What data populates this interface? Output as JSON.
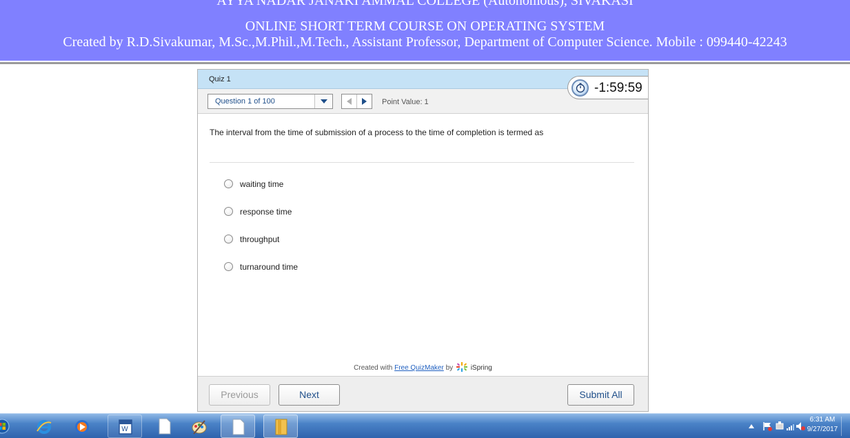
{
  "banner": {
    "line1": "AYYA NADAR JANAKI AMMAL COLLEGE (Autonomous), SIVAKASI",
    "line2": "ONLINE SHORT TERM COURSE ON OPERATING SYSTEM",
    "line3": "Created by R.D.Sivakumar, M.Sc.,M.Phil.,M.Tech., Assistant Professor, Department of Computer Science. Mobile : 099440-42243",
    "background": "#8080ff"
  },
  "quiz": {
    "title": "Quiz 1",
    "question_selector": "Question 1 of 100",
    "point_value": "Point Value: 1",
    "timer": "-1:59:59",
    "question": "The interval from the time of submission of a process to the time of completion is termed as",
    "options": [
      {
        "label": "waiting time"
      },
      {
        "label": "response time"
      },
      {
        "label": "throughput"
      },
      {
        "label": "turnaround time"
      }
    ],
    "credit": {
      "prefix": "Created with",
      "link": "Free QuizMaker",
      "by": "by",
      "brand": "iSpring"
    },
    "buttons": {
      "previous": "Previous",
      "next": "Next",
      "submit": "Submit All"
    }
  },
  "taskbar": {
    "apps": [
      "start-orb",
      "internet-explorer",
      "media-player",
      "microsoft-word",
      "document",
      "paint",
      "document",
      "file-explorer"
    ],
    "clock_time": "6:31 AM",
    "clock_date": "9/27/2017"
  }
}
